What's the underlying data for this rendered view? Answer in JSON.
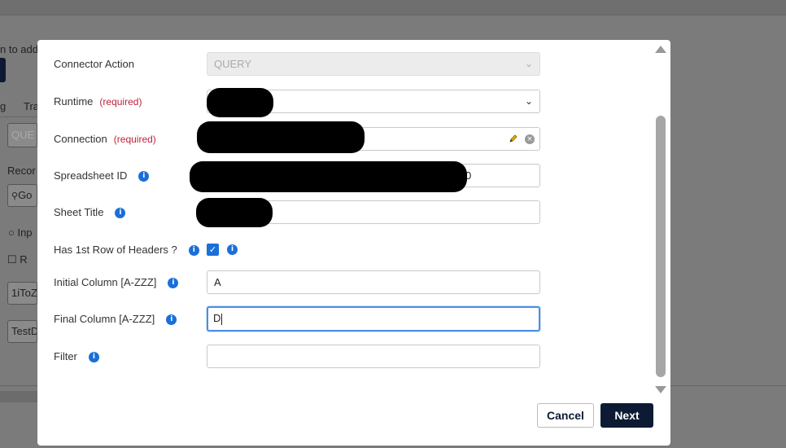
{
  "background": {
    "snippets": [
      "n to add",
      "g",
      "Tra",
      "QUE",
      "Recor",
      "Go",
      "Inp",
      "R",
      "1iToZ",
      "TestD"
    ]
  },
  "form": {
    "connector_action": {
      "label": "Connector Action",
      "value": "QUERY"
    },
    "runtime": {
      "label": "Runtime",
      "required": "(required)"
    },
    "connection": {
      "label": "Connection",
      "required": "(required)"
    },
    "spreadsheet_id": {
      "label": "Spreadsheet ID",
      "value_suffix": "0"
    },
    "sheet_title": {
      "label": "Sheet Title"
    },
    "has_headers": {
      "label": "Has 1st Row of Headers ?",
      "checked": true
    },
    "initial_column": {
      "label": "Initial Column [A-ZZZ]",
      "value": "A"
    },
    "final_column": {
      "label": "Final Column [A-ZZZ]",
      "value": "D"
    },
    "filter": {
      "label": "Filter",
      "value": ""
    }
  },
  "icons": {
    "info": "i",
    "chevron": "⌄",
    "check": "✓",
    "clear": "×"
  },
  "buttons": {
    "cancel": "Cancel",
    "next": "Next"
  },
  "colors": {
    "primary": "#0c1b33",
    "info": "#1a6fd8",
    "required": "#c0223c",
    "focus": "#4a90e2"
  }
}
